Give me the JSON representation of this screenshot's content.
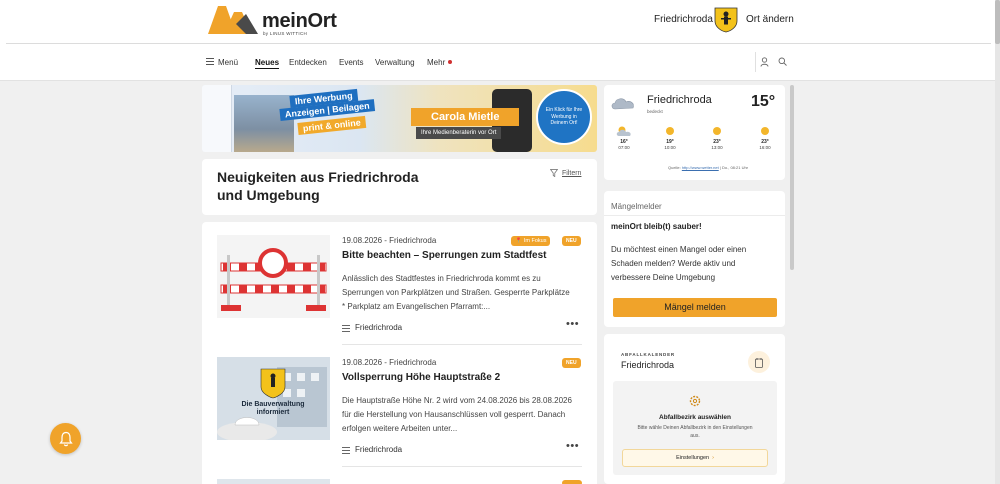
{
  "header": {
    "logo_text": "meinOrt",
    "logo_sub": "by LINUS WITTICH",
    "place": "Friedrichroda",
    "change_location": "Ort ändern"
  },
  "nav": {
    "menu": "Menü",
    "items": [
      {
        "label": "Neues",
        "active": true
      },
      {
        "label": "Entdecken",
        "active": false
      },
      {
        "label": "Events",
        "active": false
      },
      {
        "label": "Verwaltung",
        "active": false
      },
      {
        "label": "Mehr",
        "active": false
      }
    ]
  },
  "banner": {
    "line1": "Ihre Werbung",
    "line2": "Anzeigen | Beilagen",
    "line3": "print & online",
    "name": "Carola Mietle",
    "role": "Ihre Medienberaterin vor Ort",
    "circle": "Ein Klick für Ihre Werbung in Deinem Ort!"
  },
  "news_header": {
    "title": "Neuigkeiten aus Friedrichroda und Umgebung",
    "filter": "Filtern"
  },
  "news": [
    {
      "date": "19.08.2026 - Friedrichroda",
      "headline": "Bitte beachten – Sperrungen zum Stadtfest",
      "text": "Anlässlich des Stadtfestes in Friedrichroda kommt es zu Sperrungen von Parkplätzen und Straßen.   Gesperrte Parkplätze * Parkplatz am Evangelischen Pfarramt:...",
      "tag": "Friedrichroda",
      "badge_focus": "Im Fokus",
      "badge_new": "NEU"
    },
    {
      "date": "19.08.2026 - Friedrichroda",
      "headline": "Vollsperrung Höhe Hauptstraße 2",
      "text": "Die Hauptstraße Höhe Nr. 2 wird vom 24.08.2026 bis 28.08.2026 für die Herstellung von Hausanschlüssen voll gesperrt.   Danach erfolgen weitere Arbeiten unter...",
      "tag": "Friedrichroda",
      "badge_new": "NEU",
      "thumb_text": "Die Bauverwaltung informiert"
    }
  ],
  "weather": {
    "place": "Friedrichroda",
    "condition": "bedeckt",
    "temp": "15°",
    "forecast": [
      {
        "temp": "16°",
        "time": "07:00"
      },
      {
        "temp": "19°",
        "time": "10:00"
      },
      {
        "temp": "23°",
        "time": "13:00"
      },
      {
        "temp": "23°",
        "time": "16:00"
      }
    ],
    "source_label": "Quelle:",
    "source_link": "http://www.wetter.net",
    "source_time": "| Do., 08:21 Uhr"
  },
  "maengel": {
    "label": "Mängelmelder",
    "heading": "meinOrt bleib(t) sauber!",
    "text": "Du möchtest einen Mangel oder einen Schaden melden? Werde aktiv und verbessere Deine Umgebung",
    "button": "Mängel melden"
  },
  "abfall": {
    "label": "ABFALLKALENDER",
    "place": "Friedrichroda",
    "title": "Abfallbezirk auswählen",
    "subtitle": "Bitte wähle Deinen Abfallbezirk in den Einstellungen aus.",
    "button": "Einstellungen"
  },
  "colors": {
    "accent": "#f0a32a",
    "brand_blue": "#1f6fc0",
    "badge_red": "#d03030"
  }
}
